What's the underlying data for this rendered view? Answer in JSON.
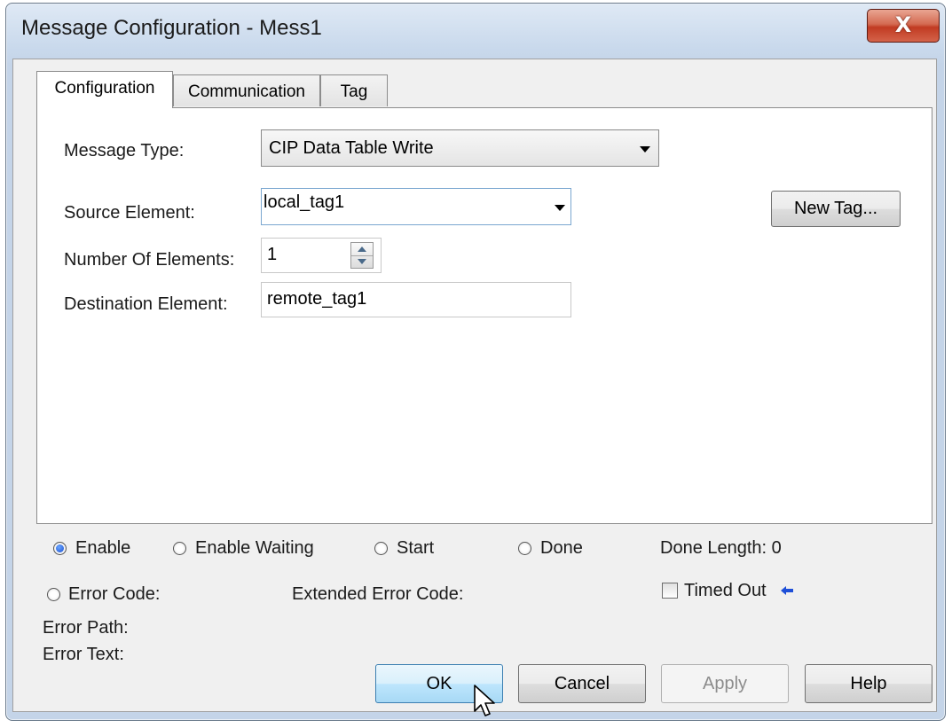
{
  "window": {
    "title": "Message Configuration - Mess1",
    "close_glyph": "X"
  },
  "tabs": [
    {
      "label": "Configuration",
      "active": true
    },
    {
      "label": "Communication",
      "active": false
    },
    {
      "label": "Tag",
      "active": false
    }
  ],
  "form": {
    "message_type_label": "Message Type:",
    "message_type_value": "CIP Data Table Write",
    "source_element_label": "Source Element:",
    "source_element_value": "local_tag1",
    "number_of_elements_label": "Number Of Elements:",
    "number_of_elements_value": "1",
    "destination_element_label": "Destination Element:",
    "destination_element_value": "remote_tag1",
    "new_tag_button": "New Tag..."
  },
  "status": {
    "enable_label": "Enable",
    "enable_selected": true,
    "enable_waiting_label": "Enable Waiting",
    "start_label": "Start",
    "done_label": "Done",
    "done_length_label": "Done Length: 0",
    "error_code_label": "Error Code:",
    "extended_error_code_label": "Extended Error Code:",
    "timed_out_label": "Timed Out",
    "timed_out_checked": false,
    "error_path_label": "Error Path:",
    "error_text_label": "Error Text:"
  },
  "buttons": {
    "ok": "OK",
    "cancel": "Cancel",
    "apply": "Apply",
    "help": "Help"
  },
  "icons": {
    "close": "close-icon",
    "dropdown": "chevron-down-icon",
    "spinner": "spinner-arrows-icon",
    "timed_out_arrow": "arrow-left-icon",
    "cursor": "mouse-cursor-icon"
  },
  "colors": {
    "accent": "#3c7fb1",
    "close_button": "#c7452b",
    "timed_out_arrow": "#1e4fd8"
  }
}
